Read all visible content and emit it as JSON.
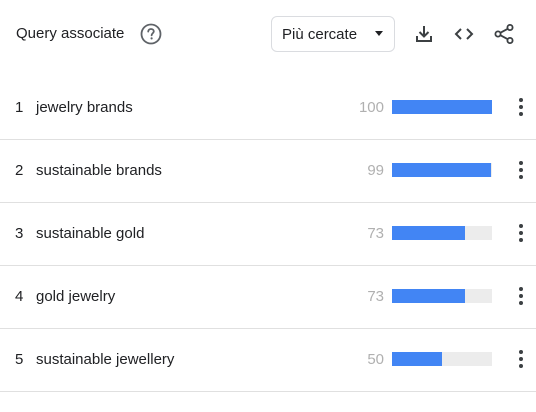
{
  "header": {
    "title": "Query associate",
    "help_icon": "help-circle-icon",
    "dropdown": {
      "selected": "Più cercate",
      "icon": "caret-down-icon"
    },
    "tools": [
      {
        "name": "download-icon",
        "icon": "download-icon"
      },
      {
        "name": "embed-code-icon",
        "icon": "code-brackets-icon"
      },
      {
        "name": "share-icon",
        "icon": "share-icon"
      }
    ]
  },
  "colors": {
    "bar": "#4285f4",
    "bar_track": "#ececec",
    "value_text": "#b0b0b0",
    "divider": "#e0e0e0"
  },
  "rows": [
    {
      "rank": "1",
      "query": "jewelry brands",
      "value": "100",
      "fill": 1.0
    },
    {
      "rank": "2",
      "query": "sustainable brands",
      "value": "99",
      "fill": 0.99
    },
    {
      "rank": "3",
      "query": "sustainable gold",
      "value": "73",
      "fill": 0.73
    },
    {
      "rank": "4",
      "query": "gold jewelry",
      "value": "73",
      "fill": 0.73
    },
    {
      "rank": "5",
      "query": "sustainable jewellery",
      "value": "50",
      "fill": 0.5
    }
  ]
}
